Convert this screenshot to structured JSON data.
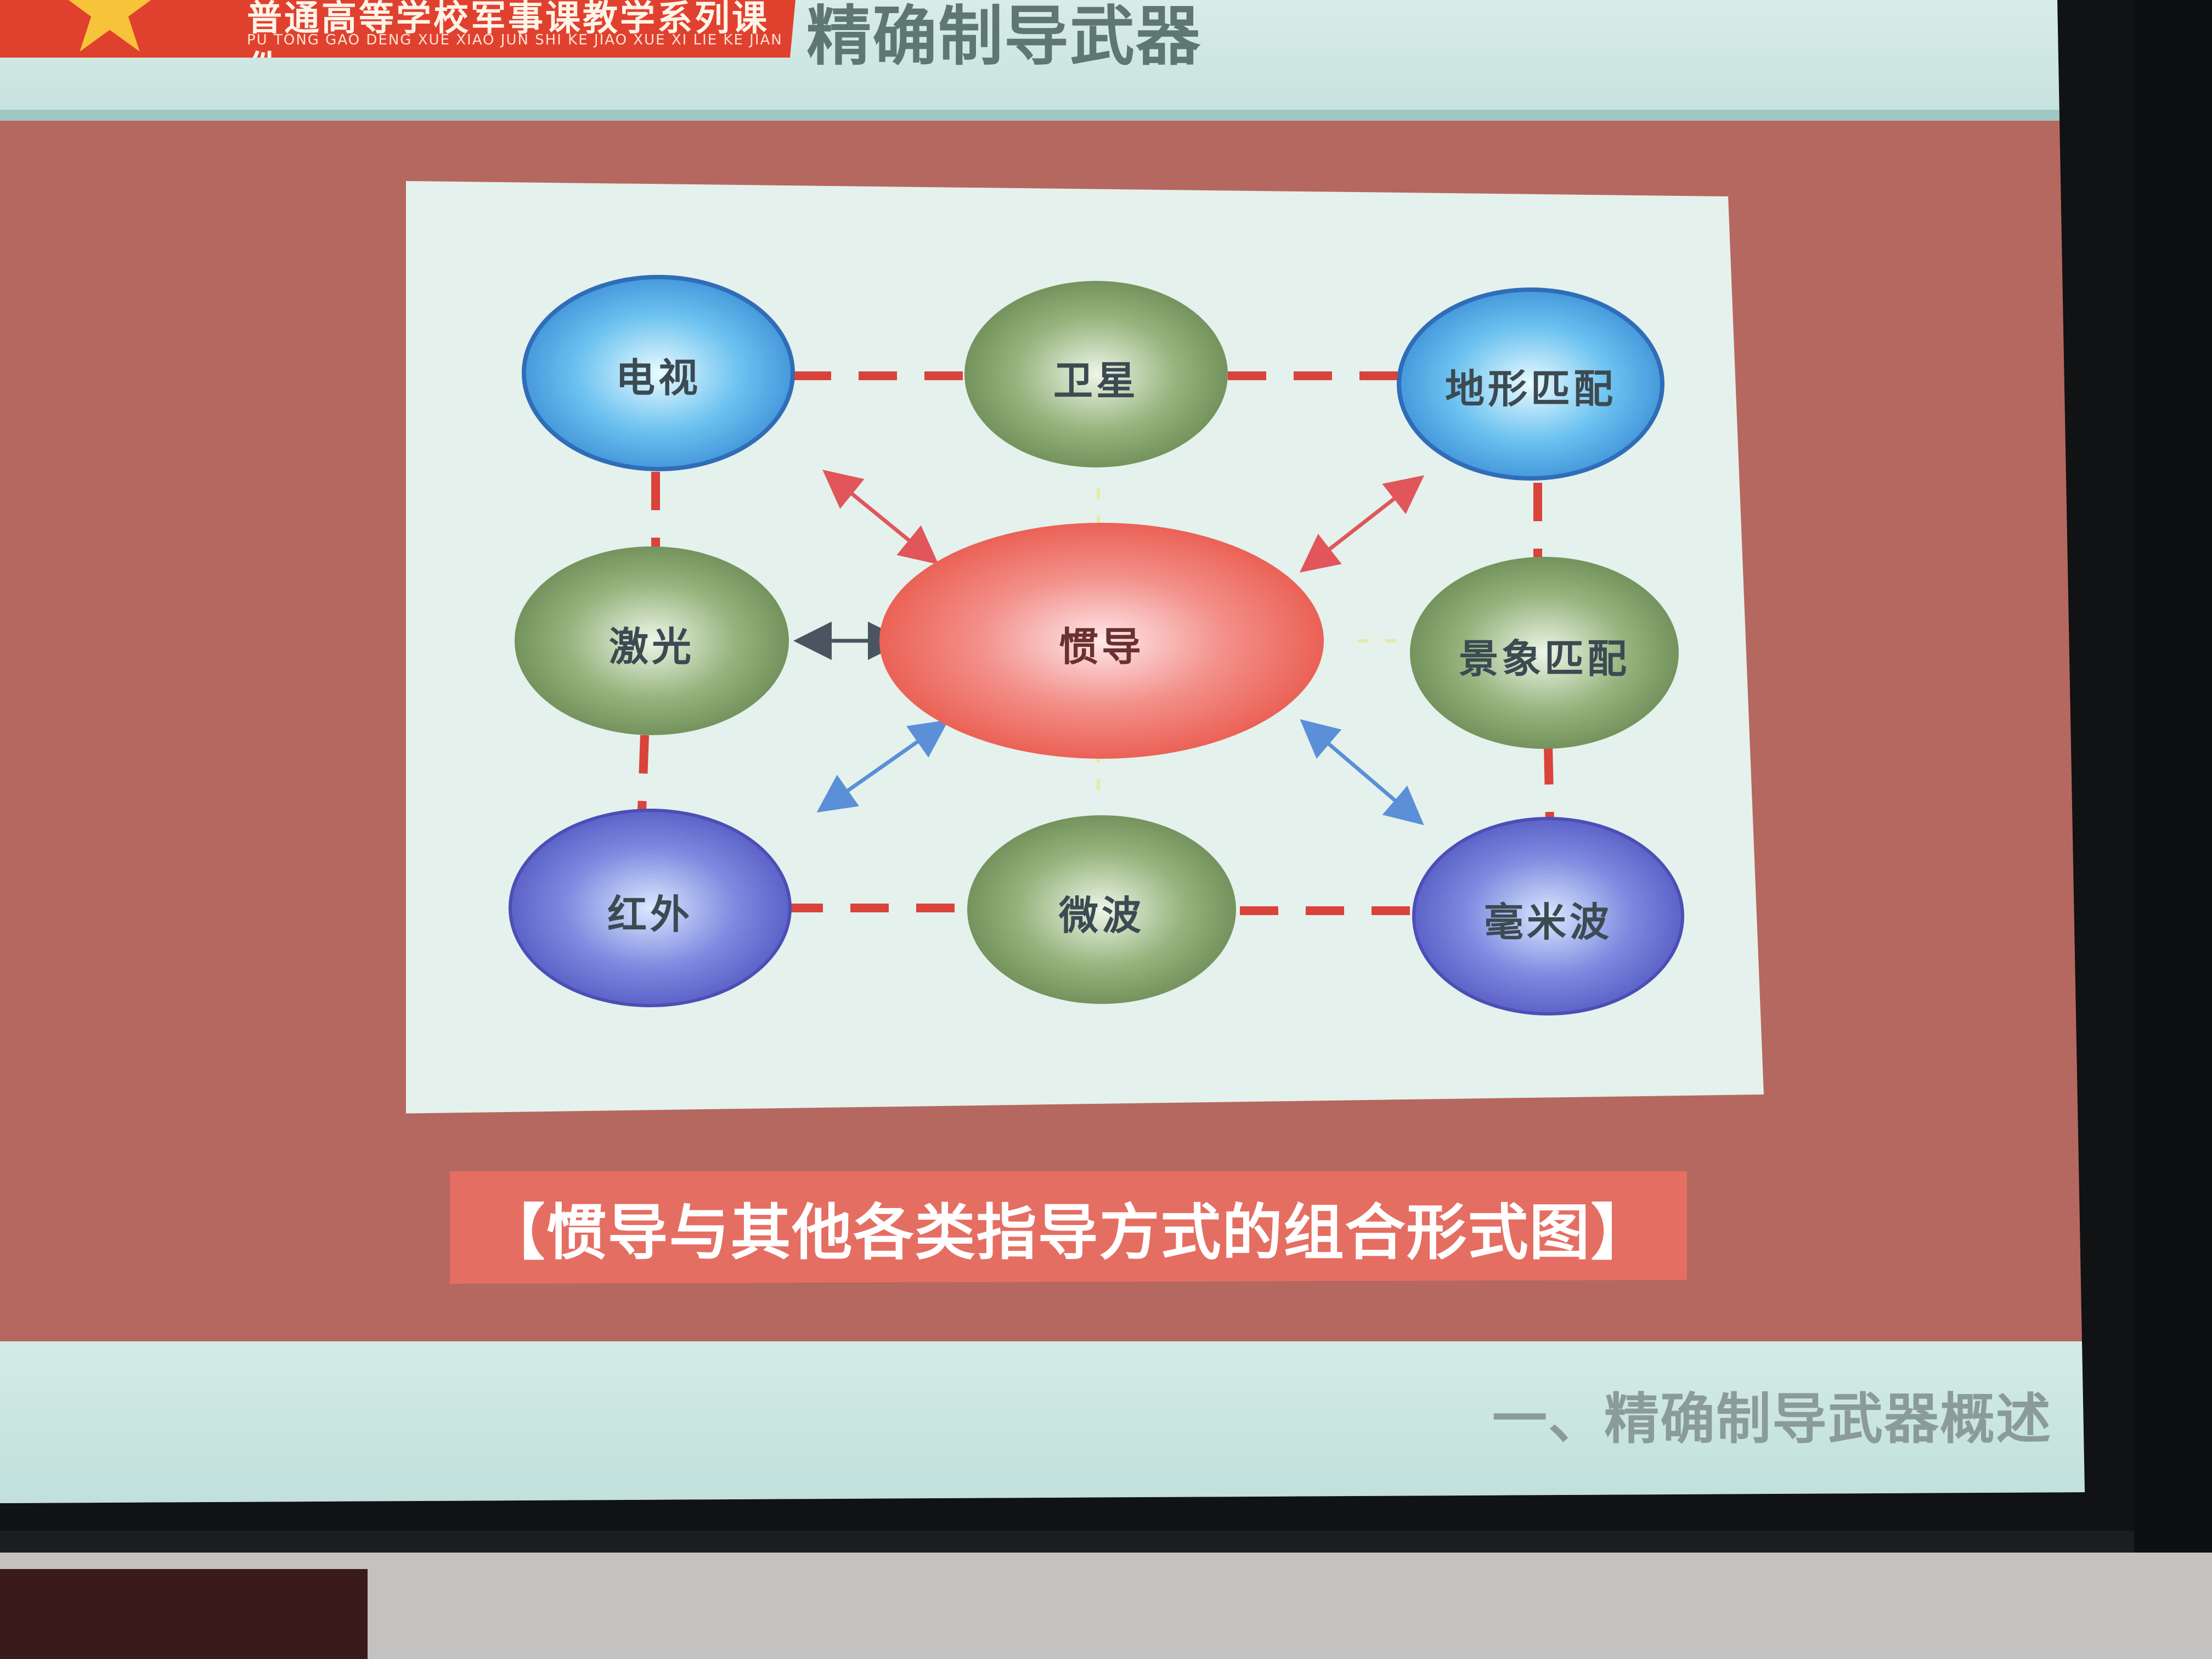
{
  "header": {
    "emblem_icon": "star-emblem-icon",
    "course_title": "普通高等学校军事课教学系列课件",
    "course_pinyin": "PU TONG GAO DENG XUE XIAO JUN SHI KE JIAO XUE XI LIE KE JIAN",
    "slide_title": "精确制导武器"
  },
  "diagram": {
    "center": "惯导",
    "nodes": {
      "tv": "电视",
      "satellite": "卫星",
      "terrain": "地形匹配",
      "laser": "激光",
      "scene": "景象匹配",
      "infrared": "红外",
      "microwave": "微波",
      "mmwave": "毫米波"
    },
    "colors": {
      "blue": "#4aa6e6",
      "green": "#7b9a63",
      "purple": "#5f6ad0",
      "center": "#ef6a58",
      "dashes": "#d9433a",
      "arrow_red": "#e0565a",
      "arrow_blue": "#5b8fd8",
      "arrow_dark": "#4a5560"
    }
  },
  "caption": "【惯导与其他各类指导方式的组合形式图】",
  "footer": {
    "section": "一、精确制导武器概述"
  }
}
